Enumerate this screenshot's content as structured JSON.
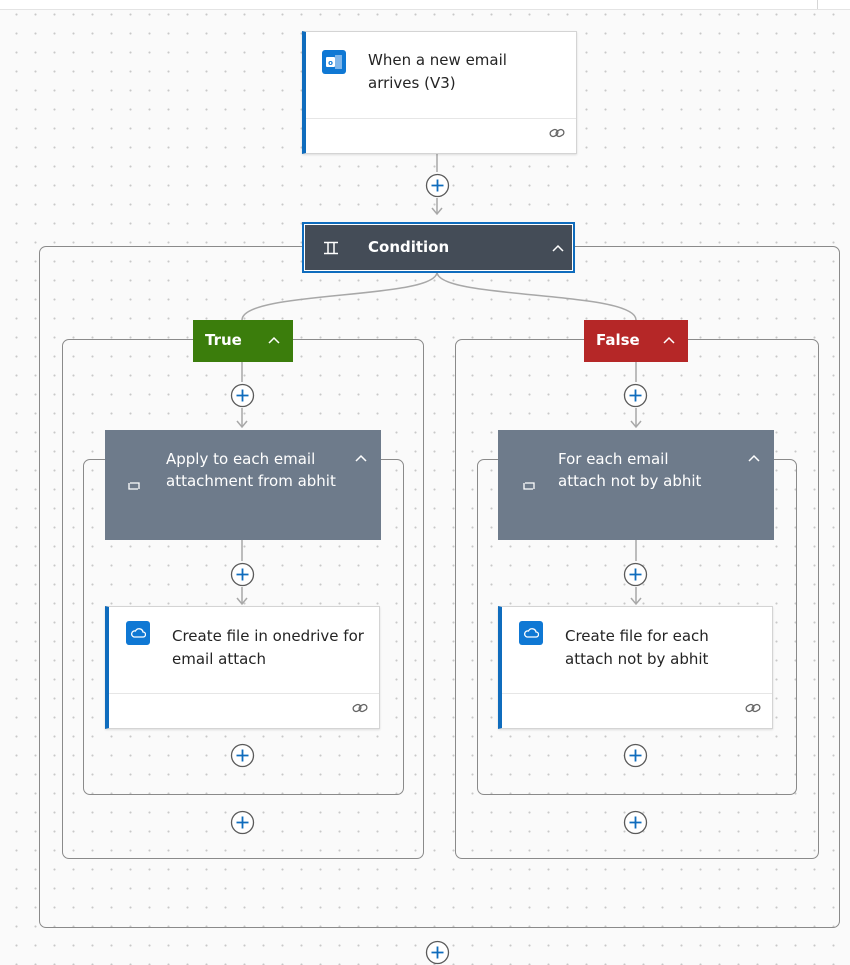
{
  "trigger": {
    "title": "When a new email arrives (V3)",
    "icon": "outlook-icon"
  },
  "condition": {
    "title": "Condition",
    "icon": "condition-icon"
  },
  "branches": {
    "true": {
      "label": "True",
      "color": "#3b7d0c"
    },
    "false": {
      "label": "False",
      "color": "#b52727"
    }
  },
  "true_loop": {
    "title": "Apply to each email attachment from abhit",
    "icon": "loop-icon"
  },
  "true_action": {
    "title": "Create file in onedrive for email attach",
    "icon": "onedrive-icon"
  },
  "false_loop": {
    "title": "For each email attach not by abhit",
    "icon": "loop-icon"
  },
  "false_action": {
    "title": "Create file for each attach not by abhit",
    "icon": "onedrive-icon"
  },
  "colors": {
    "accent": "#0f6cbd",
    "condition_header": "#444c57",
    "loop_header": "#6e7b8b"
  }
}
